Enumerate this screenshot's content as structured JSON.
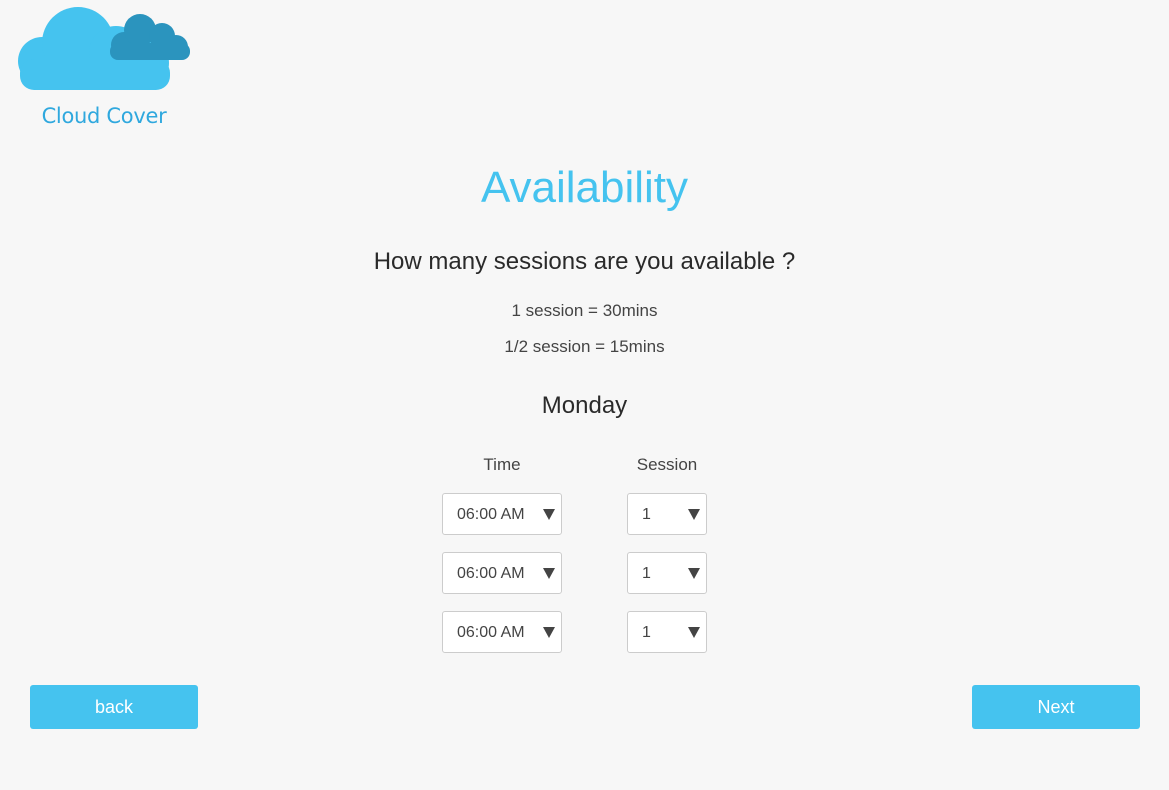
{
  "brand": {
    "name": "Cloud Cover",
    "primary_color": "#45c3ef",
    "secondary_color": "#2b94be"
  },
  "page": {
    "title": "Availability",
    "question": "How many sessions are you available ?",
    "notes": [
      "1 session = 30mins",
      "1/2 session = 15mins"
    ],
    "day": "Monday"
  },
  "table": {
    "headers": {
      "time": "Time",
      "session": "Session"
    },
    "rows": [
      {
        "time": "06:00 AM",
        "session": "1"
      },
      {
        "time": "06:00 AM",
        "session": "1"
      },
      {
        "time": "06:00 AM",
        "session": "1"
      }
    ]
  },
  "buttons": {
    "back": "back",
    "next": "Next"
  }
}
